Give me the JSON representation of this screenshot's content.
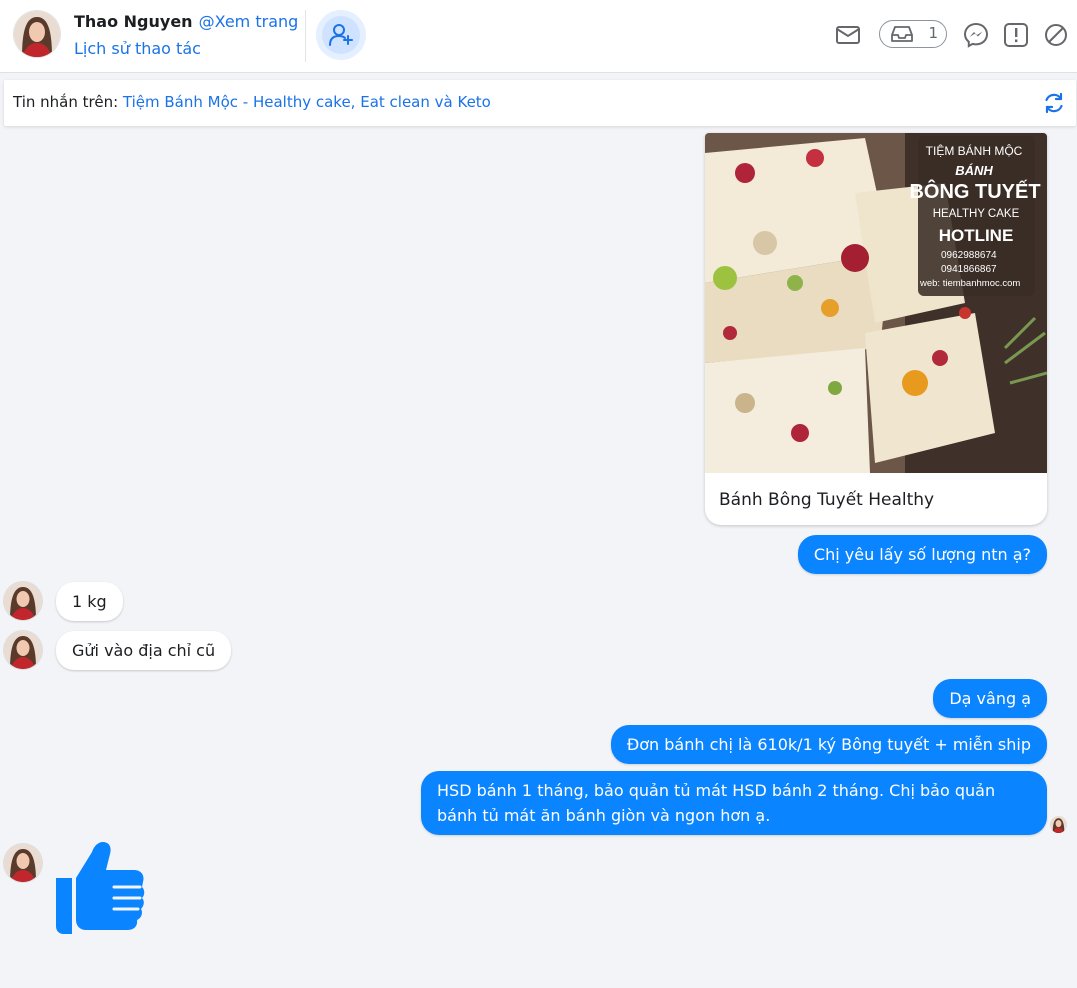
{
  "header": {
    "user_name": "Thao Nguyen",
    "view_page": "@Xem trang",
    "history_link": "Lịch sử thao tác",
    "inbox_count": "1",
    "icons": [
      "mail-icon",
      "inbox-icon",
      "messenger-icon",
      "report-icon",
      "block-icon"
    ]
  },
  "source_bar": {
    "label": "Tin nhắn trên: ",
    "page_name": "Tiệm Bánh Mộc - Healthy cake, Eat clean và Keto"
  },
  "product_card": {
    "title": "Bánh Bông Tuyết Healthy",
    "image_overlay": {
      "shop": "TIỆM BÁNH MỘC",
      "line1": "BÁNH",
      "line2": "BÔNG TUYẾT",
      "line3": "HEALTHY CAKE",
      "line4": "HOTLINE",
      "phone1": "0962988674",
      "phone2": "0941866867",
      "web": "web: tiembanhmoc.com"
    }
  },
  "messages": [
    {
      "id": "m1",
      "direction": "out",
      "text": "Chị yêu lấy số lượng ntn ạ?"
    },
    {
      "id": "m2",
      "direction": "in",
      "text": "1 kg"
    },
    {
      "id": "m3",
      "direction": "in",
      "text": "Gửi vào địa chỉ cũ"
    },
    {
      "id": "m4",
      "direction": "out",
      "text": "Dạ vâng ạ"
    },
    {
      "id": "m5",
      "direction": "out",
      "text": "Đơn bánh chị là 610k/1 ký Bông tuyết + miễn ship"
    },
    {
      "id": "m6",
      "direction": "out",
      "text": "HSD bánh 1 tháng, bảo quản tủ mát HSD bánh 2 tháng. Chị bảo quản bánh tủ mát ăn bánh giòn và ngon hơn ạ."
    },
    {
      "id": "m7",
      "direction": "in",
      "text": "",
      "sticker": "thumbs-up"
    }
  ],
  "colors": {
    "accent": "#1a73e8",
    "outgoing_bubble": "#0a84ff",
    "like": "#0a84ff",
    "background": "#f3f4f7"
  }
}
